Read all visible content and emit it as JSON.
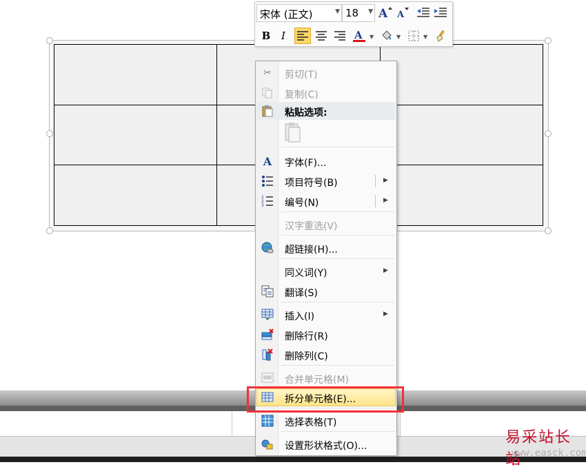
{
  "mini_toolbar": {
    "font_name": "宋体 (正文)",
    "font_size": "18"
  },
  "context_menu": {
    "items": [
      {
        "label": "剪切(T)",
        "icon": "scissors-icon"
      },
      {
        "label": "复制(C)",
        "icon": "copy-icon"
      },
      {
        "label": "粘贴选项:",
        "icon": "paste-icon"
      },
      {
        "label": "字体(F)...",
        "icon": "font-icon"
      },
      {
        "label": "项目符号(B)",
        "icon": "bullets-icon"
      },
      {
        "label": "编号(N)",
        "icon": "numbering-icon"
      },
      {
        "label": "汉字重选(V)",
        "icon": ""
      },
      {
        "label": "超链接(H)...",
        "icon": "hyperlink-icon"
      },
      {
        "label": "同义词(Y)",
        "icon": ""
      },
      {
        "label": "翻译(S)",
        "icon": "translate-icon"
      },
      {
        "label": "插入(I)",
        "icon": "insert-table-icon"
      },
      {
        "label": "删除行(R)",
        "icon": "delete-row-icon"
      },
      {
        "label": "删除列(C)",
        "icon": "delete-column-icon"
      },
      {
        "label": "合并单元格(M)",
        "icon": "merge-cells-icon"
      },
      {
        "label": "拆分单元格(E)...",
        "icon": "split-cells-icon"
      },
      {
        "label": "选择表格(T)",
        "icon": "select-table-icon"
      },
      {
        "label": "设置形状格式(O)...",
        "icon": "format-shape-icon"
      }
    ],
    "highlighted": "拆分单元格(E)..."
  },
  "watermark": {
    "name": "易采站长站",
    "url": "www.easck.com"
  },
  "colors": {
    "highlight_box": "#f3303a",
    "font_color_underline": "#e0101a",
    "active_button": "#fbd866"
  }
}
